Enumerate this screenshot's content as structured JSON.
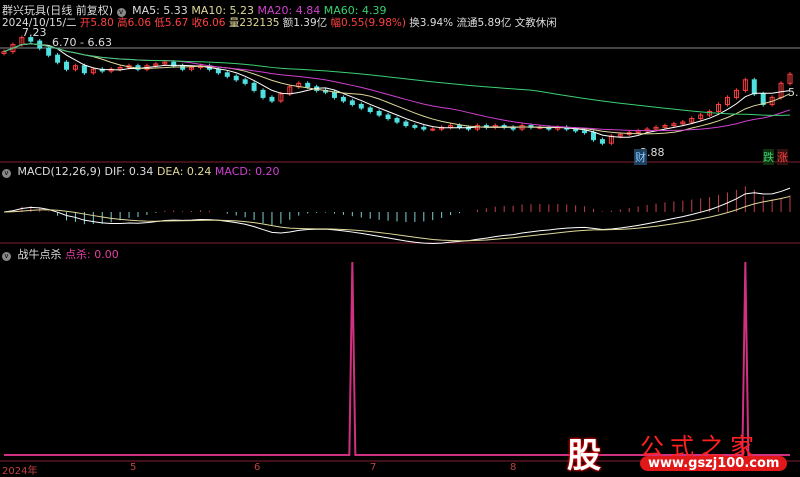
{
  "header": {
    "name": "群兴玩具(日线 前复权)",
    "ma5": "MA5: 5.33",
    "ma10": "MA10: 5.23",
    "ma20": "MA20: 4.84",
    "ma60": "MA60: 4.39"
  },
  "quote": {
    "date": "2024/10/15/二",
    "open_l": "开",
    "open": "5.80",
    "high_l": "高",
    "high": "6.06",
    "low_l": "低",
    "low": "5.67",
    "close_l": "收",
    "close": "6.06",
    "vol": "量232135",
    "amt": "额1.39亿",
    "chg_l": "幅",
    "chg": "0.55(9.98%)",
    "turn": "换3.94%",
    "float": "流通5.89亿",
    "sector": "文教休闲"
  },
  "labels": {
    "high_mark": "7.23",
    "range": "6.70 - 6.63",
    "low_mark": "3.88",
    "last": "5.",
    "cai": "财",
    "die": "跌",
    "zhang": "涨"
  },
  "macd": {
    "title": "MACD(12,26,9)",
    "dif": "DIF: 0.34",
    "dea": "DEA: 0.24",
    "macd": "MACD: 0.20"
  },
  "ind": {
    "title": "战牛点杀",
    "val_l": "点杀:",
    "val": "0.00"
  },
  "axis": [
    "2024年",
    "5",
    "6",
    "7",
    "8"
  ],
  "logo": {
    "char": "股",
    "name": "公式之家",
    "url": "www.gszj100.com"
  },
  "colors": {
    "up": "#ff4040",
    "down": "#50e0e0",
    "ma5": "#ffffff",
    "ma10": "#e0d89a",
    "ma20": "#d040d0",
    "ma60": "#3cd070",
    "spike": "#d03080"
  },
  "chart_data": {
    "type": "candlestick",
    "closes": [
      6.7,
      6.9,
      7.1,
      7.0,
      6.8,
      6.6,
      6.4,
      6.2,
      6.3,
      6.1,
      6.2,
      6.15,
      6.2,
      6.25,
      6.3,
      6.2,
      6.3,
      6.35,
      6.4,
      6.3,
      6.2,
      6.25,
      6.3,
      6.2,
      6.1,
      6.0,
      5.9,
      5.8,
      5.6,
      5.4,
      5.3,
      5.5,
      5.7,
      5.8,
      5.7,
      5.6,
      5.55,
      5.4,
      5.3,
      5.2,
      5.1,
      5.0,
      4.9,
      4.8,
      4.7,
      4.6,
      4.55,
      4.5,
      4.5,
      4.55,
      4.6,
      4.55,
      4.5,
      4.6,
      4.55,
      4.6,
      4.55,
      4.5,
      4.6,
      4.55,
      4.55,
      4.5,
      4.55,
      4.5,
      4.45,
      4.4,
      4.2,
      4.1,
      4.3,
      4.35,
      4.4,
      4.45,
      4.5,
      4.55,
      4.6,
      4.65,
      4.7,
      4.8,
      4.9,
      5.0,
      5.2,
      5.4,
      5.6,
      5.9,
      5.5,
      5.2,
      5.4,
      5.8,
      6.06
    ],
    "signals": [
      39,
      83
    ]
  }
}
